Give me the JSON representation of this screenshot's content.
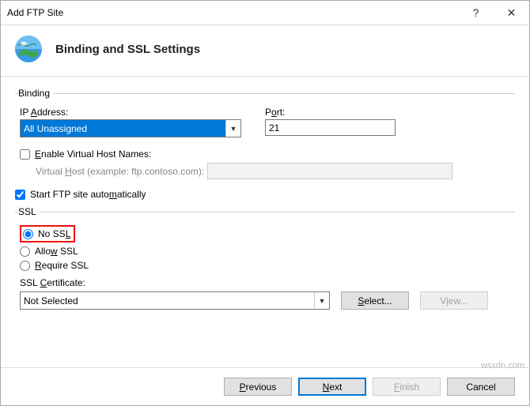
{
  "window": {
    "title": "Add FTP Site",
    "help": "?",
    "close": "✕"
  },
  "header": {
    "title": "Binding and SSL Settings"
  },
  "binding": {
    "legend": "Binding",
    "ip_label_pre": "IP ",
    "ip_label_u": "A",
    "ip_label_post": "ddress:",
    "ip_value": "All Unassigned",
    "port_label_pre": "P",
    "port_label_u": "o",
    "port_label_post": "rt:",
    "port_value": "21",
    "enable_vh_pre": "",
    "enable_vh_u": "E",
    "enable_vh_post": "nable Virtual Host Names:",
    "vh_label_pre": "Virtual ",
    "vh_label_u": "H",
    "vh_label_post": "ost (example: ftp.contoso.com):",
    "vh_value": ""
  },
  "start_auto": {
    "pre": "Start FTP site auto",
    "u": "m",
    "post": "atically"
  },
  "ssl": {
    "legend": "SSL",
    "no_pre": "No SS",
    "no_u": "L",
    "no_post": "",
    "allow_pre": "Allo",
    "allow_u": "w",
    "allow_post": " SSL",
    "req_u": "R",
    "req_post": "equire SSL",
    "cert_label_pre": "SSL ",
    "cert_label_u": "C",
    "cert_label_post": "ertificate:",
    "cert_value": "Not Selected",
    "select_btn_u": "S",
    "select_btn_post": "elect...",
    "view_btn_pre": "V",
    "view_btn_u": "i",
    "view_btn_post": "ew..."
  },
  "footer": {
    "prev_u": "P",
    "prev_post": "revious",
    "next_u": "N",
    "next_post": "ext",
    "finish_u": "F",
    "finish_post": "inish",
    "cancel": "Cancel"
  },
  "watermark": "wsxdn.com"
}
